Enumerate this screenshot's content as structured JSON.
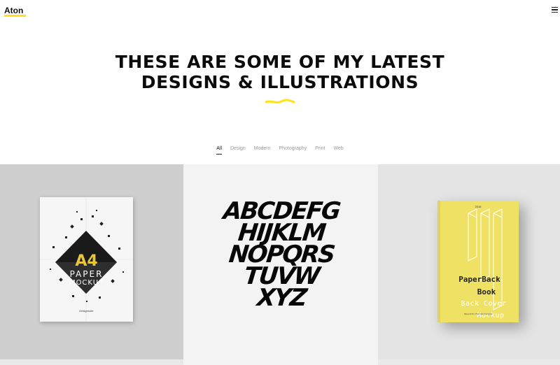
{
  "header": {
    "logo": "Aton"
  },
  "hero": {
    "line1": "THESE ARE SOME OF MY LATEST",
    "line2": "DESIGNS & ILLUSTRATIONS"
  },
  "filters": [
    {
      "label": "All",
      "active": true
    },
    {
      "label": "Design"
    },
    {
      "label": "Modern"
    },
    {
      "label": "Photography"
    },
    {
      "label": "Print"
    },
    {
      "label": "Web"
    }
  ],
  "portfolio": [
    {
      "big": "A4",
      "word1": "PAPER",
      "word2": "MOCKUP",
      "signature": "Designnote"
    },
    {
      "lines": [
        "ABCDEFG",
        "HIJKLM",
        "NOPQRS",
        "TUVW",
        "XYZ"
      ]
    },
    {
      "year": "2016",
      "title1": "PaperBack",
      "title2": "Book",
      "title3": "Back Cover",
      "title4": "Mockup",
      "footer": "REALISTIC PSD RESOURCE"
    }
  ],
  "colors": {
    "accent": "#ffe11a",
    "book": "#efe164"
  }
}
